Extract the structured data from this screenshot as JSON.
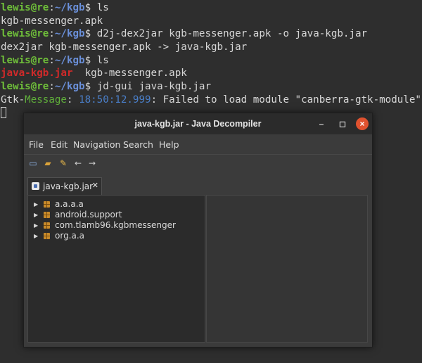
{
  "terminal": {
    "prompt_user": "lewis@re",
    "prompt_sep": ":",
    "prompt_path": "~/kgb",
    "prompt_end": "$ ",
    "lines": [
      {
        "type": "cmd",
        "text": "ls"
      },
      {
        "type": "out",
        "text": "kgb-messenger.apk"
      },
      {
        "type": "cmd",
        "text": "d2j-dex2jar kgb-messenger.apk -o java-kgb.jar"
      },
      {
        "type": "out",
        "text": "dex2jar kgb-messenger.apk -> java-kgb.jar"
      },
      {
        "type": "cmd",
        "text": "ls"
      },
      {
        "type": "ls",
        "red": "java-kgb.jar",
        "rest": "  kgb-messenger.apk"
      },
      {
        "type": "cmd",
        "text": "jd-gui java-kgb.jar"
      },
      {
        "type": "gtk",
        "word": "Gtk-",
        "msg": "Message",
        "sep": ": ",
        "time": "18:50:12.999",
        "rest": ": Failed to load module \"canberra-gtk-module\""
      }
    ]
  },
  "window": {
    "title": "java-kgb.jar - Java Decompiler",
    "minimize_glyph": "–",
    "maximize_glyph": "◻",
    "close_glyph": "×",
    "menu": [
      "File",
      "Edit",
      "Navigation",
      "Search",
      "Help"
    ],
    "toolbar": [
      {
        "name": "open-file-icon",
        "glyph": "▭"
      },
      {
        "name": "open-folder-icon",
        "glyph": "▰"
      },
      {
        "name": "edit-icon",
        "glyph": "✎"
      },
      {
        "name": "back-arrow-icon",
        "glyph": "←"
      },
      {
        "name": "forward-arrow-icon",
        "glyph": "→"
      }
    ],
    "tab": {
      "label": "java-kgb.jar",
      "close": "✕"
    },
    "tree": [
      {
        "label": "a.a.a.a"
      },
      {
        "label": "android.support"
      },
      {
        "label": "com.tlamb96.kgbmessenger"
      },
      {
        "label": "org.a.a"
      }
    ],
    "expander_glyph": "▶"
  }
}
